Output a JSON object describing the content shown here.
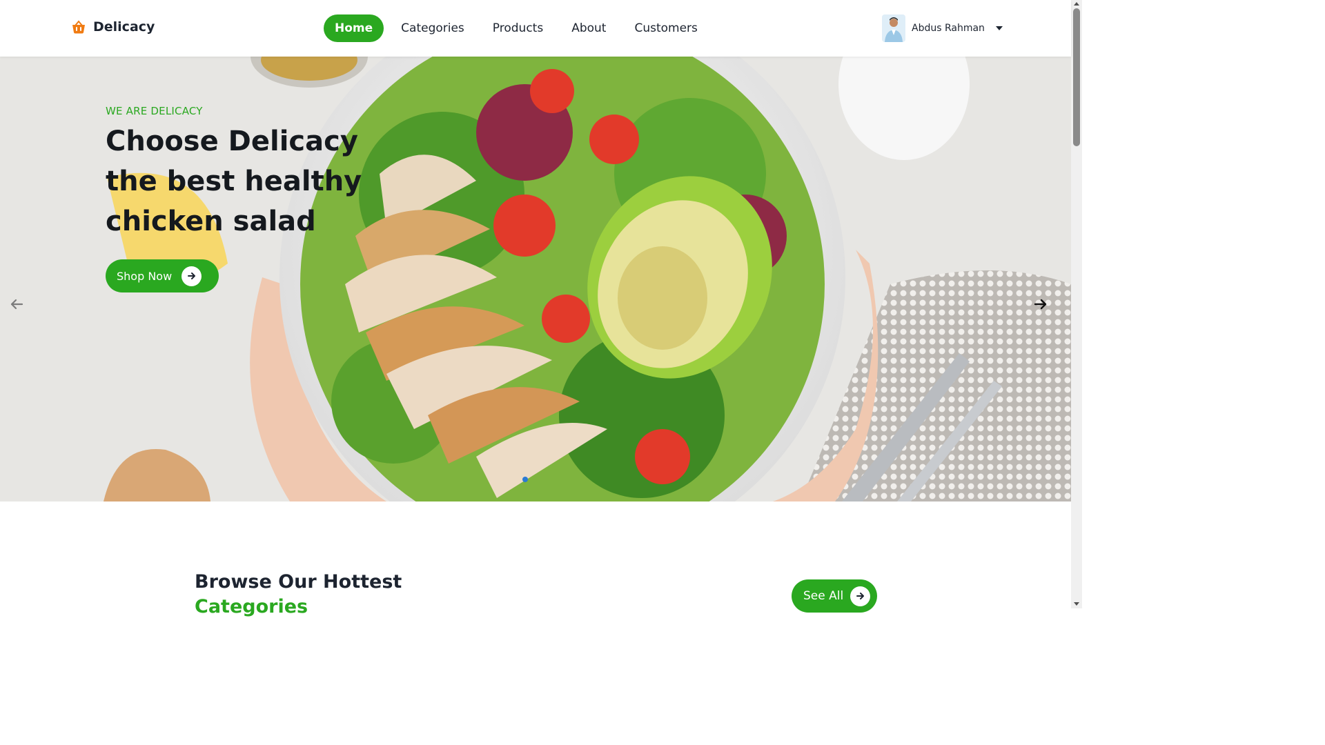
{
  "brand": {
    "name": "Delicacy",
    "accent": "#2aa820",
    "logo_icon": "basket-icon"
  },
  "nav": {
    "items": [
      {
        "label": "Home",
        "active": true
      },
      {
        "label": "Categories",
        "active": false
      },
      {
        "label": "Products",
        "active": false
      },
      {
        "label": "About",
        "active": false
      },
      {
        "label": "Customers",
        "active": false
      }
    ]
  },
  "user": {
    "name": "Abdus Rahman",
    "menu_icon": "caret-down-icon"
  },
  "hero": {
    "eyebrow": "WE ARE DELICACY",
    "title": "Choose Delicacy the best healthy chicken salad",
    "cta_label": "Shop Now",
    "prev_icon": "arrow-left-icon",
    "next_icon": "arrow-right-icon"
  },
  "browse": {
    "title": "Browse Our Hottest",
    "subtitle": "Categories",
    "cta_label": "See All"
  }
}
